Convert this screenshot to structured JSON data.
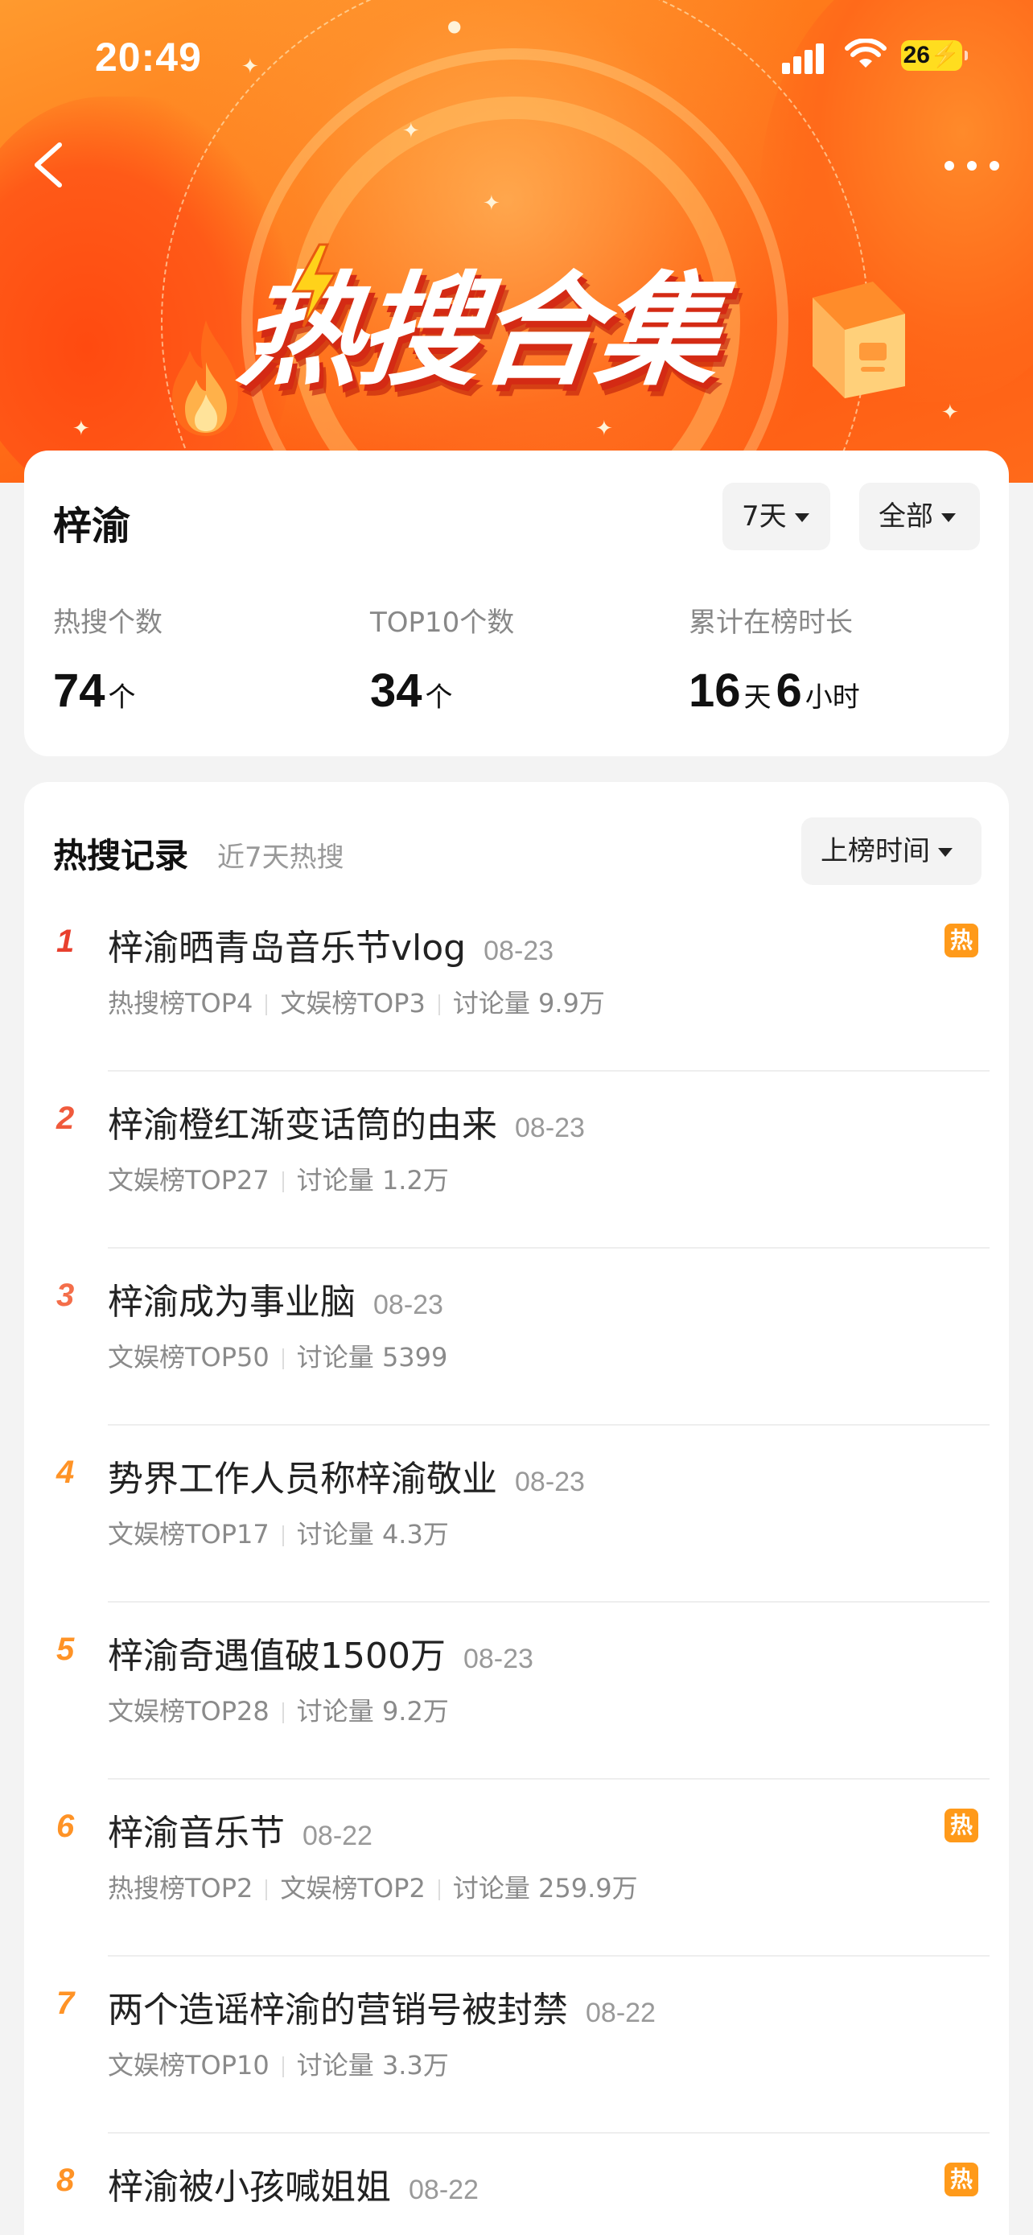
{
  "status_bar": {
    "time": "20:49",
    "battery": "26"
  },
  "summary": {
    "name": "梓渝",
    "filter_days": "7天",
    "filter_scope": "全部",
    "stats": [
      {
        "label": "热搜个数",
        "value": "74",
        "unit": "个"
      },
      {
        "label": "TOP10个数",
        "value": "34",
        "unit": "个"
      },
      {
        "label": "累计在榜时长",
        "days": "16",
        "days_unit": "天",
        "hours": "6",
        "hours_unit": "小时"
      }
    ]
  },
  "records": {
    "title": "热搜记录",
    "subtitle": "近7天热搜",
    "sort_label": "上榜时间",
    "hot_badge": "热",
    "items": [
      {
        "rank": "1",
        "title": "梓渝晒青岛音乐节vlog",
        "date": "08-23",
        "meta": [
          "热搜榜TOP4",
          "文娱榜TOP3",
          "讨论量 9.9万"
        ],
        "hot": true,
        "rank_color": "#e8402e"
      },
      {
        "rank": "2",
        "title": "梓渝橙红渐变话筒的由来",
        "date": "08-23",
        "meta": [
          "文娱榜TOP27",
          "讨论量 1.2万"
        ],
        "hot": false,
        "rank_color": "#f05a3c"
      },
      {
        "rank": "3",
        "title": "梓渝成为事业脑",
        "date": "08-23",
        "meta": [
          "文娱榜TOP50",
          "讨论量 5399"
        ],
        "hot": false,
        "rank_color": "#f46e4a"
      },
      {
        "rank": "4",
        "title": "势界工作人员称梓渝敬业",
        "date": "08-23",
        "meta": [
          "文娱榜TOP17",
          "讨论量 4.3万"
        ],
        "hot": false,
        "rank_color": "#ff9326"
      },
      {
        "rank": "5",
        "title": "梓渝奇遇值破1500万",
        "date": "08-23",
        "meta": [
          "文娱榜TOP28",
          "讨论量 9.2万"
        ],
        "hot": false,
        "rank_color": "#ff9326"
      },
      {
        "rank": "6",
        "title": "梓渝音乐节",
        "date": "08-22",
        "meta": [
          "热搜榜TOP2",
          "文娱榜TOP2",
          "讨论量 259.9万"
        ],
        "hot": true,
        "rank_color": "#ff9326"
      },
      {
        "rank": "7",
        "title": "两个造谣梓渝的营销号被封禁",
        "date": "08-22",
        "meta": [
          "文娱榜TOP10",
          "讨论量 3.3万"
        ],
        "hot": false,
        "rank_color": "#ff9326"
      },
      {
        "rank": "8",
        "title": "梓渝被小孩喊姐姐",
        "date": "08-22",
        "meta": [],
        "hot": true,
        "rank_color": "#ff9326"
      }
    ]
  },
  "hero": {
    "title": "热搜合集"
  },
  "colors": {
    "accent": "#ff6a1a",
    "hot_badge": "#ff9a1a",
    "rank_top": "#e8402e",
    "rank_rest": "#ff9326"
  }
}
